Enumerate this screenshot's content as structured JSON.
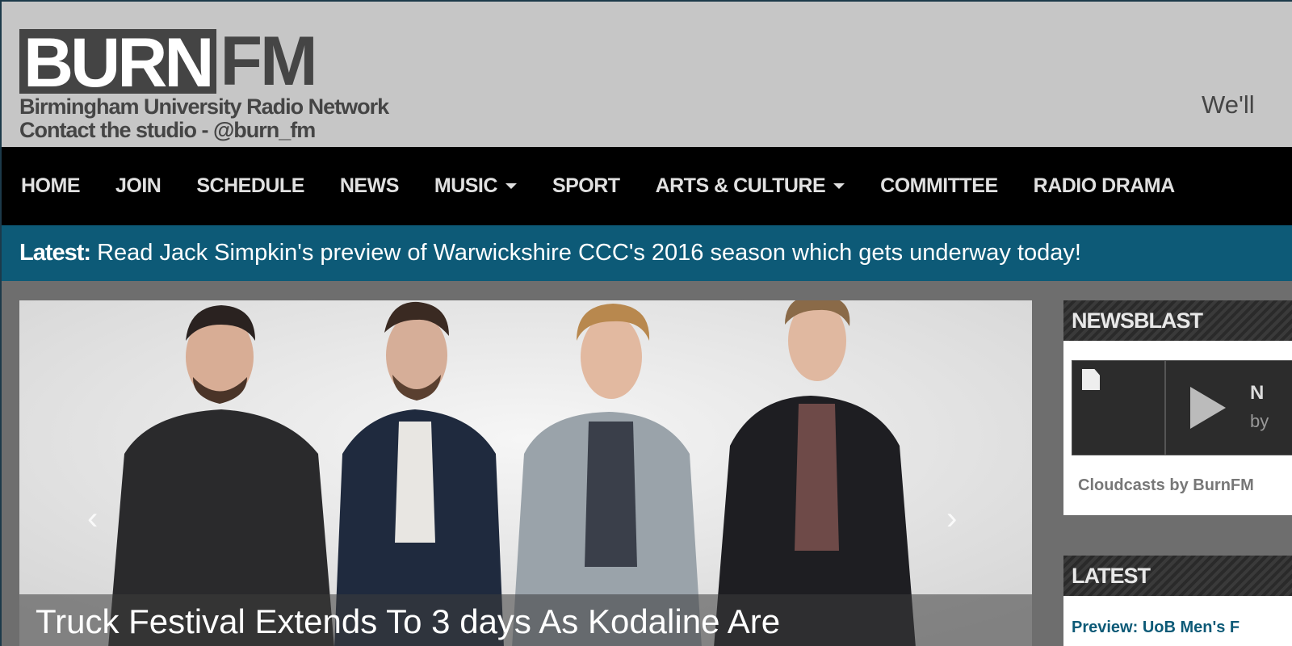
{
  "header": {
    "logo_part1": "BURN",
    "logo_part2": "FM",
    "tagline_line1": "Birmingham University Radio Network",
    "tagline_line2": "Contact the studio - @burn_fm",
    "right_text": "We'll"
  },
  "nav": {
    "items": [
      {
        "label": "HOME",
        "dropdown": false
      },
      {
        "label": "JOIN",
        "dropdown": false
      },
      {
        "label": "SCHEDULE",
        "dropdown": false
      },
      {
        "label": "NEWS",
        "dropdown": false
      },
      {
        "label": "MUSIC",
        "dropdown": true
      },
      {
        "label": "SPORT",
        "dropdown": false
      },
      {
        "label": "ARTS & CULTURE",
        "dropdown": true
      },
      {
        "label": "COMMITTEE",
        "dropdown": false
      },
      {
        "label": "RADIO DRAMA",
        "dropdown": false
      }
    ]
  },
  "ticker": {
    "label": "Latest:",
    "text": "Read Jack Simpkin's preview of Warwickshire CCC's 2016 season which gets underway today!"
  },
  "slider": {
    "caption": "Truck Festival Extends To 3 days As Kodaline Are",
    "prev_icon": "‹",
    "next_icon": "›"
  },
  "sidebar": {
    "newsblast": {
      "title": "NEWSBLAST",
      "player_title": "N",
      "player_by": "by",
      "link": "Cloudcasts by BurnFM"
    },
    "latest": {
      "title": "LATEST",
      "first_item": "Preview: UoB Men's F"
    }
  },
  "colors": {
    "header_bg": "#c6c6c6",
    "nav_bg": "#000000",
    "ticker_bg": "#0d5a77",
    "page_bg": "#6e6e6e"
  }
}
